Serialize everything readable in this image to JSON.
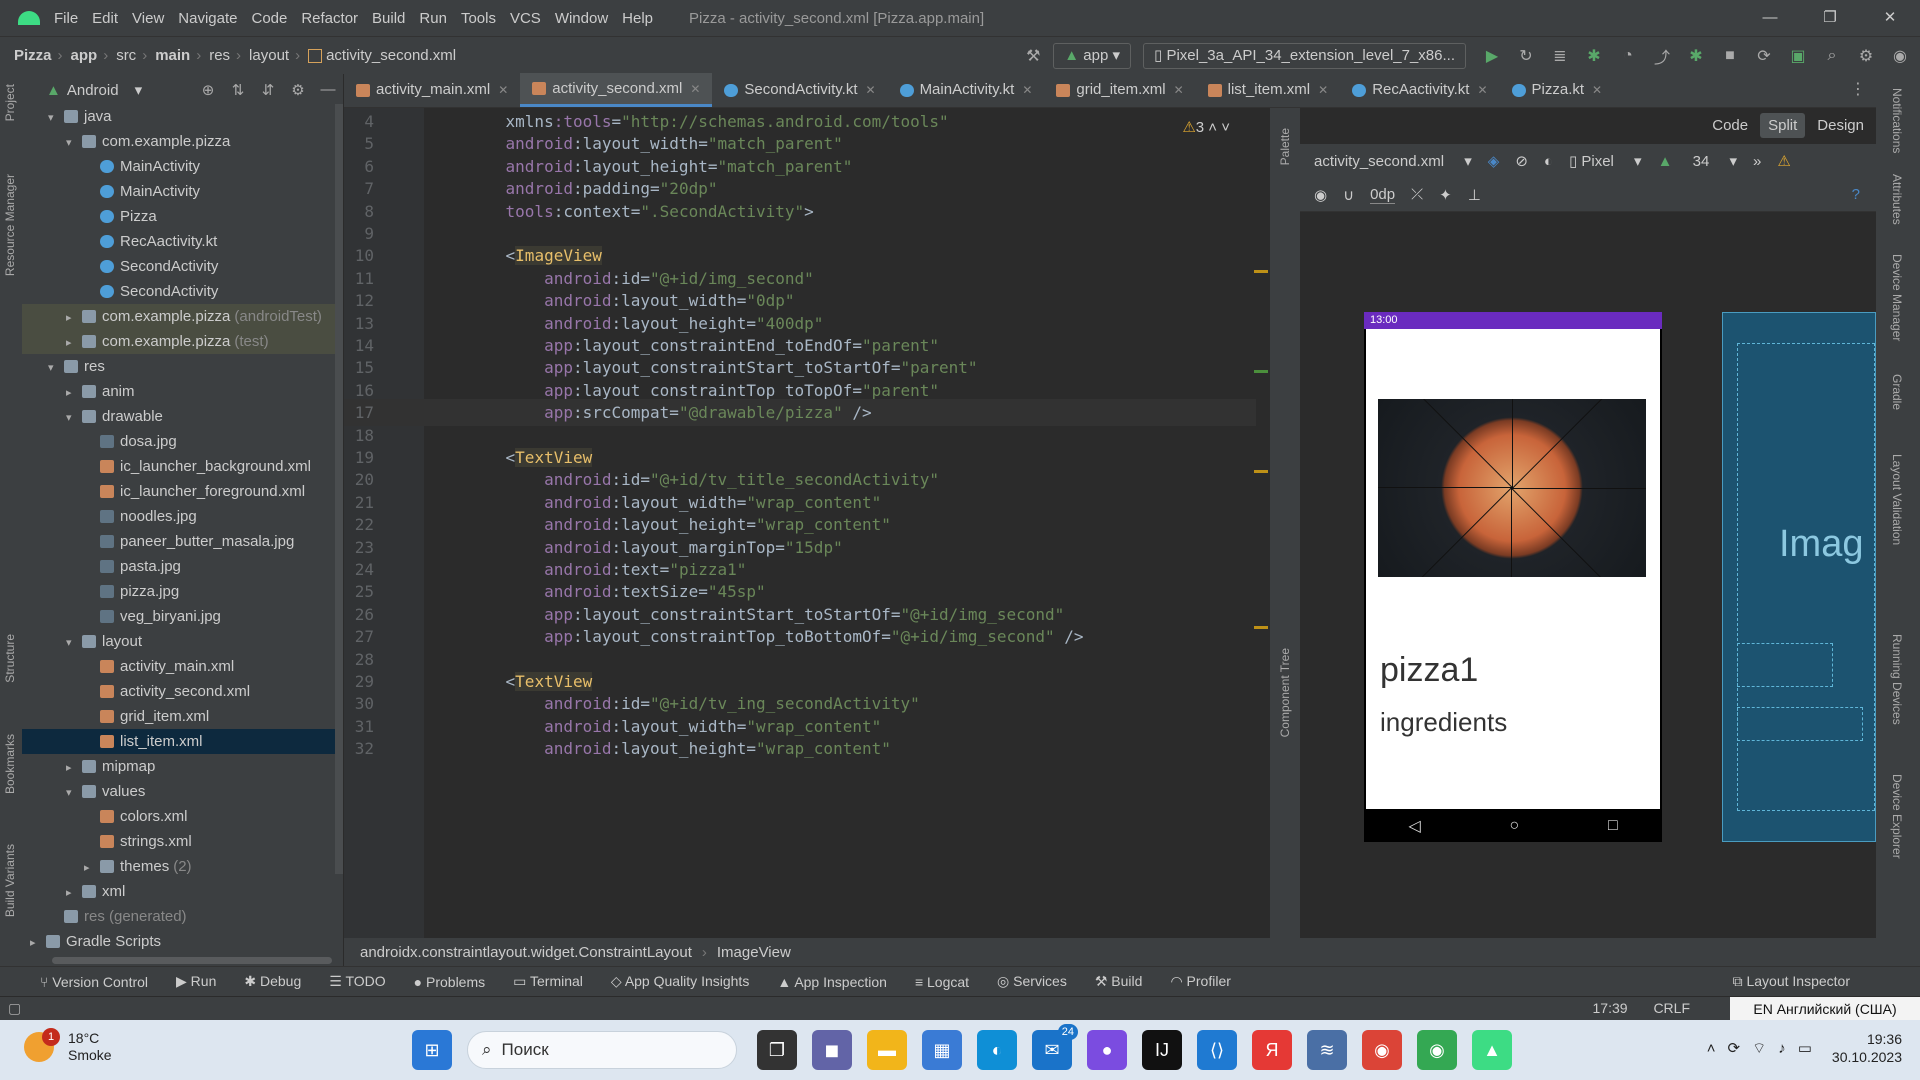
{
  "window": {
    "title": "Pizza - activity_second.xml [Pizza.app.main]",
    "menu": [
      "File",
      "Edit",
      "View",
      "Navigate",
      "Code",
      "Refactor",
      "Build",
      "Run",
      "Tools",
      "VCS",
      "Window",
      "Help"
    ],
    "controls": [
      "—",
      "❐",
      "✕"
    ]
  },
  "nav": {
    "crumbs": [
      "Pizza",
      "app",
      "src",
      "main",
      "res",
      "layout"
    ],
    "file": "activity_second.xml",
    "run_config": "app",
    "device": "Pixel_3a_API_34_extension_level_7_x86..."
  },
  "project": {
    "view": "Android",
    "tree": [
      {
        "label": "java",
        "depth": 1,
        "arrow": "▾",
        "icon": "folder"
      },
      {
        "label": "com.example.pizza",
        "depth": 2,
        "arrow": "▾",
        "icon": "pkg"
      },
      {
        "label": "MainActivity",
        "depth": 3,
        "icon": "kt"
      },
      {
        "label": "MainActivity",
        "depth": 3,
        "icon": "kt"
      },
      {
        "label": "Pizza",
        "depth": 3,
        "icon": "kt"
      },
      {
        "label": "RecAactivity.kt",
        "depth": 3,
        "icon": "kt"
      },
      {
        "label": "SecondActivity",
        "depth": 3,
        "icon": "kt"
      },
      {
        "label": "SecondActivity",
        "depth": 3,
        "icon": "kt"
      },
      {
        "label": "com.example.pizza",
        "suffix": "(androidTest)",
        "depth": 2,
        "arrow": "▸",
        "icon": "pkg",
        "hl": true
      },
      {
        "label": "com.example.pizza",
        "suffix": "(test)",
        "depth": 2,
        "arrow": "▸",
        "icon": "pkg",
        "hl": true
      },
      {
        "label": "res",
        "depth": 1,
        "arrow": "▾",
        "icon": "folder"
      },
      {
        "label": "anim",
        "depth": 2,
        "arrow": "▸",
        "icon": "folder"
      },
      {
        "label": "drawable",
        "depth": 2,
        "arrow": "▾",
        "icon": "folder"
      },
      {
        "label": "dosa.jpg",
        "depth": 3,
        "icon": "img"
      },
      {
        "label": "ic_launcher_background.xml",
        "depth": 3,
        "icon": "xml"
      },
      {
        "label": "ic_launcher_foreground.xml",
        "depth": 3,
        "icon": "xml"
      },
      {
        "label": "noodles.jpg",
        "depth": 3,
        "icon": "img"
      },
      {
        "label": "paneer_butter_masala.jpg",
        "depth": 3,
        "icon": "img"
      },
      {
        "label": "pasta.jpg",
        "depth": 3,
        "icon": "img"
      },
      {
        "label": "pizza.jpg",
        "depth": 3,
        "icon": "img"
      },
      {
        "label": "veg_biryani.jpg",
        "depth": 3,
        "icon": "img"
      },
      {
        "label": "layout",
        "depth": 2,
        "arrow": "▾",
        "icon": "folder"
      },
      {
        "label": "activity_main.xml",
        "depth": 3,
        "icon": "xml"
      },
      {
        "label": "activity_second.xml",
        "depth": 3,
        "icon": "xml"
      },
      {
        "label": "grid_item.xml",
        "depth": 3,
        "icon": "xml"
      },
      {
        "label": "list_item.xml",
        "depth": 3,
        "icon": "xml",
        "sel": true
      },
      {
        "label": "mipmap",
        "depth": 2,
        "arrow": "▸",
        "icon": "folder"
      },
      {
        "label": "values",
        "depth": 2,
        "arrow": "▾",
        "icon": "folder"
      },
      {
        "label": "colors.xml",
        "depth": 3,
        "icon": "xml"
      },
      {
        "label": "strings.xml",
        "depth": 3,
        "icon": "xml"
      },
      {
        "label": "themes",
        "suffix": "(2)",
        "depth": 3,
        "arrow": "▸",
        "icon": "folder"
      },
      {
        "label": "xml",
        "depth": 2,
        "arrow": "▸",
        "icon": "folder"
      },
      {
        "label": "res (generated)",
        "depth": 1,
        "icon": "folder",
        "dim": true
      },
      {
        "label": "Gradle Scripts",
        "depth": 0,
        "arrow": "▸",
        "icon": "folder"
      }
    ]
  },
  "tabs": [
    {
      "label": "activity_main.xml"
    },
    {
      "label": "activity_second.xml",
      "active": true
    },
    {
      "label": "SecondActivity.kt"
    },
    {
      "label": "MainActivity.kt"
    },
    {
      "label": "grid_item.xml"
    },
    {
      "label": "list_item.xml"
    },
    {
      "label": "RecAactivity.kt"
    },
    {
      "label": "Pizza.kt"
    }
  ],
  "editor": {
    "warnings": "3",
    "current_line": 17,
    "lines": [
      {
        "n": 4,
        "c": [
          [
            "    ",
            ""
          ],
          [
            "xmlns",
            ""
          ],
          [
            ":tools",
            "ns"
          ],
          [
            "=",
            ""
          ],
          [
            "\"http://schemas.android.com/tools\"",
            "str"
          ]
        ]
      },
      {
        "n": 5,
        "c": [
          [
            "    ",
            ""
          ],
          [
            "android",
            "ns"
          ],
          [
            ":layout_width",
            ""
          ],
          [
            "=",
            ""
          ],
          [
            "\"match_parent\"",
            "str"
          ]
        ]
      },
      {
        "n": 6,
        "c": [
          [
            "    ",
            ""
          ],
          [
            "android",
            "ns"
          ],
          [
            ":layout_height",
            ""
          ],
          [
            "=",
            ""
          ],
          [
            "\"match_parent\"",
            "str"
          ]
        ]
      },
      {
        "n": 7,
        "c": [
          [
            "    ",
            ""
          ],
          [
            "android",
            "ns"
          ],
          [
            ":padding",
            ""
          ],
          [
            "=",
            ""
          ],
          [
            "\"20dp\"",
            "str"
          ]
        ]
      },
      {
        "n": 8,
        "c": [
          [
            "    ",
            ""
          ],
          [
            "tools",
            "ns"
          ],
          [
            ":context",
            ""
          ],
          [
            "=",
            ""
          ],
          [
            "\".SecondActivity\"",
            "str"
          ],
          [
            ">",
            ""
          ]
        ]
      },
      {
        "n": 9,
        "c": []
      },
      {
        "n": 10,
        "c": [
          [
            "    ",
            ""
          ],
          [
            "<",
            ""
          ],
          [
            "ImageView",
            "tag"
          ]
        ]
      },
      {
        "n": 11,
        "c": [
          [
            "        ",
            ""
          ],
          [
            "android",
            "ns"
          ],
          [
            ":id",
            ""
          ],
          [
            "=",
            ""
          ],
          [
            "\"@+id/img_second\"",
            "str"
          ]
        ]
      },
      {
        "n": 12,
        "c": [
          [
            "        ",
            ""
          ],
          [
            "android",
            "ns"
          ],
          [
            ":layout_width",
            ""
          ],
          [
            "=",
            ""
          ],
          [
            "\"0dp\"",
            "str"
          ]
        ]
      },
      {
        "n": 13,
        "c": [
          [
            "        ",
            ""
          ],
          [
            "android",
            "ns"
          ],
          [
            ":layout_height",
            ""
          ],
          [
            "=",
            ""
          ],
          [
            "\"400dp\"",
            "str"
          ]
        ]
      },
      {
        "n": 14,
        "c": [
          [
            "        ",
            ""
          ],
          [
            "app",
            "ns"
          ],
          [
            ":layout_constraintEnd_toEndOf",
            ""
          ],
          [
            "=",
            ""
          ],
          [
            "\"parent\"",
            "str"
          ]
        ]
      },
      {
        "n": 15,
        "c": [
          [
            "        ",
            ""
          ],
          [
            "app",
            "ns"
          ],
          [
            ":layout_constraintStart_toStartOf",
            ""
          ],
          [
            "=",
            ""
          ],
          [
            "\"parent\"",
            "str"
          ]
        ]
      },
      {
        "n": 16,
        "c": [
          [
            "        ",
            ""
          ],
          [
            "app",
            "ns"
          ],
          [
            ":layout_constraintTop_toTopOf",
            ""
          ],
          [
            "=",
            ""
          ],
          [
            "\"parent\"",
            "str"
          ]
        ]
      },
      {
        "n": 17,
        "c": [
          [
            "        ",
            ""
          ],
          [
            "app",
            "ns"
          ],
          [
            ":srcCompat",
            ""
          ],
          [
            "=",
            ""
          ],
          [
            "\"@drawable/pizza\"",
            "str"
          ],
          [
            " />",
            ""
          ]
        ]
      },
      {
        "n": 18,
        "c": []
      },
      {
        "n": 19,
        "c": [
          [
            "    ",
            ""
          ],
          [
            "<",
            ""
          ],
          [
            "TextView",
            "tag"
          ]
        ]
      },
      {
        "n": 20,
        "c": [
          [
            "        ",
            ""
          ],
          [
            "android",
            "ns"
          ],
          [
            ":id",
            ""
          ],
          [
            "=",
            ""
          ],
          [
            "\"@+id/tv_title_secondActivity\"",
            "str"
          ]
        ]
      },
      {
        "n": 21,
        "c": [
          [
            "        ",
            ""
          ],
          [
            "android",
            "ns"
          ],
          [
            ":layout_width",
            ""
          ],
          [
            "=",
            ""
          ],
          [
            "\"wrap_content\"",
            "str"
          ]
        ]
      },
      {
        "n": 22,
        "c": [
          [
            "        ",
            ""
          ],
          [
            "android",
            "ns"
          ],
          [
            ":layout_height",
            ""
          ],
          [
            "=",
            ""
          ],
          [
            "\"wrap_content\"",
            "str"
          ]
        ]
      },
      {
        "n": 23,
        "c": [
          [
            "        ",
            ""
          ],
          [
            "android",
            "ns"
          ],
          [
            ":layout_marginTop",
            ""
          ],
          [
            "=",
            ""
          ],
          [
            "\"15dp\"",
            "str"
          ]
        ]
      },
      {
        "n": 24,
        "c": [
          [
            "        ",
            ""
          ],
          [
            "android",
            "ns"
          ],
          [
            ":text",
            ""
          ],
          [
            "=",
            ""
          ],
          [
            "\"pizza1\"",
            "str"
          ]
        ]
      },
      {
        "n": 25,
        "c": [
          [
            "        ",
            ""
          ],
          [
            "android",
            "ns"
          ],
          [
            ":textSize",
            ""
          ],
          [
            "=",
            ""
          ],
          [
            "\"45sp\"",
            "str"
          ]
        ]
      },
      {
        "n": 26,
        "c": [
          [
            "        ",
            ""
          ],
          [
            "app",
            "ns"
          ],
          [
            ":layout_constraintStart_toStartOf",
            ""
          ],
          [
            "=",
            ""
          ],
          [
            "\"@+id/img_second\"",
            "str"
          ]
        ]
      },
      {
        "n": 27,
        "c": [
          [
            "        ",
            ""
          ],
          [
            "app",
            "ns"
          ],
          [
            ":layout_constraintTop_toBottomOf",
            ""
          ],
          [
            "=",
            ""
          ],
          [
            "\"@+id/img_second\"",
            "str"
          ],
          [
            " />",
            ""
          ]
        ]
      },
      {
        "n": 28,
        "c": []
      },
      {
        "n": 29,
        "c": [
          [
            "    ",
            ""
          ],
          [
            "<",
            ""
          ],
          [
            "TextView",
            "tag"
          ]
        ]
      },
      {
        "n": 30,
        "c": [
          [
            "        ",
            ""
          ],
          [
            "android",
            "ns"
          ],
          [
            ":id",
            ""
          ],
          [
            "=",
            ""
          ],
          [
            "\"@+id/tv_ing_secondActivity\"",
            "str"
          ]
        ]
      },
      {
        "n": 31,
        "c": [
          [
            "        ",
            ""
          ],
          [
            "android",
            "ns"
          ],
          [
            ":layout_width",
            ""
          ],
          [
            "=",
            ""
          ],
          [
            "\"wrap_content\"",
            "str"
          ]
        ]
      },
      {
        "n": 32,
        "c": [
          [
            "        ",
            ""
          ],
          [
            "android",
            "ns"
          ],
          [
            ":layout_height",
            ""
          ],
          [
            "=",
            ""
          ],
          [
            "\"wrap_content\"",
            "str"
          ]
        ]
      }
    ]
  },
  "preview": {
    "modes": [
      "Code",
      "Split",
      "Design"
    ],
    "active_mode": "Split",
    "file": "activity_second.xml",
    "device": "Pixel",
    "api": "34",
    "margin": "0dp",
    "phone_time": "13:00",
    "title_text": "pizza1",
    "ingredients_text": "ingredients",
    "blueprint_text": "Imag"
  },
  "side_labels": {
    "left": [
      "Project",
      "Resource Manager",
      "Structure",
      "Bookmarks",
      "Build Variants"
    ],
    "right": [
      "Notifications",
      "Attributes",
      "Device Manager",
      "Gradle",
      "Layout Validation",
      "Running Devices",
      "Device Explorer"
    ],
    "preview_left": [
      "Palette",
      "Component Tree"
    ]
  },
  "breadcrumb": [
    "androidx.constraintlayout.widget.ConstraintLayout",
    "ImageView"
  ],
  "toolwindows": [
    "Version Control",
    "Run",
    "Debug",
    "TODO",
    "Problems",
    "Terminal",
    "App Quality Insights",
    "App Inspection",
    "Logcat",
    "Services",
    "Build",
    "Profiler"
  ],
  "layout_inspector": "Layout Inspector",
  "status": {
    "position": "17:39",
    "line_sep": "CRLF",
    "lang": "EN Английский (США)"
  },
  "taskbar": {
    "temp": "18°C",
    "weather": "Smoke",
    "weather_badge": "1",
    "search": "Поиск",
    "mail_badge": "24",
    "time": "19:36",
    "date": "30.10.2023"
  }
}
